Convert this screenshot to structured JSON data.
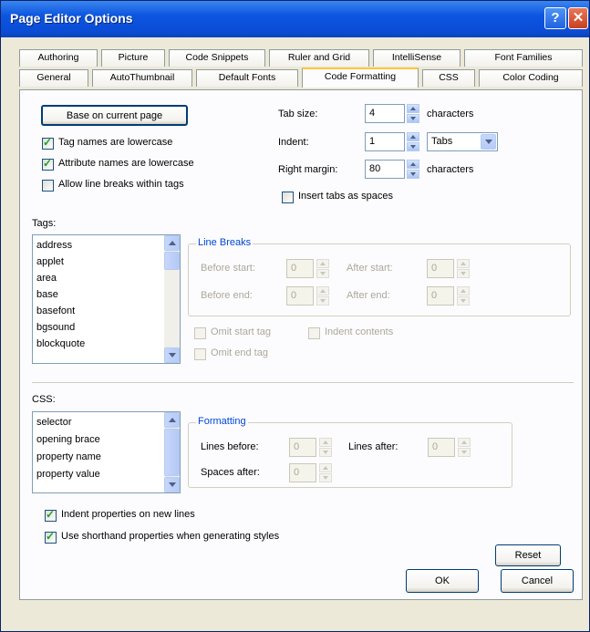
{
  "window": {
    "title": "Page Editor Options",
    "help_glyph": "?",
    "close_glyph": "✕"
  },
  "tabs_row1": [
    "Authoring",
    "Picture",
    "Code Snippets",
    "Ruler and Grid",
    "IntelliSense",
    "Font Families"
  ],
  "tabs_row2": [
    "General",
    "AutoThumbnail",
    "Default Fonts",
    "Code Formatting",
    "CSS",
    "Color Coding"
  ],
  "active_tab": "Code Formatting",
  "code_formatting": {
    "base_button": "Base on current page",
    "checkboxes": [
      {
        "label": "Tag names are lowercase",
        "checked": true
      },
      {
        "label": "Attribute names are lowercase",
        "checked": true
      },
      {
        "label": "Allow line breaks within tags",
        "checked": false
      }
    ],
    "tab_size": {
      "label": "Tab size:",
      "value": "4",
      "suffix": "characters"
    },
    "indent": {
      "label": "Indent:",
      "value": "1",
      "unit": "Tabs"
    },
    "right_margin": {
      "label": "Right margin:",
      "value": "80",
      "suffix": "characters"
    },
    "insert_tabs": {
      "label": "Insert tabs as spaces",
      "checked": false
    }
  },
  "tags": {
    "label": "Tags:",
    "items": [
      "address",
      "applet",
      "area",
      "base",
      "basefont",
      "bgsound",
      "blockquote"
    ],
    "line_breaks": {
      "title": "Line Breaks",
      "before_start": "Before start:",
      "after_start": "After start:",
      "before_end": "Before end:",
      "after_end": "After end:",
      "before_start_value": "0",
      "after_start_value": "0",
      "before_end_value": "0",
      "after_end_value": "0"
    },
    "omit_start": "Omit start tag",
    "indent_contents": "Indent contents",
    "omit_end": "Omit end tag"
  },
  "css": {
    "label": "CSS:",
    "items": [
      "selector",
      "opening brace",
      "property name",
      "property value"
    ],
    "formatting": {
      "title": "Formatting",
      "lines_before": "Lines before:",
      "lines_after": "Lines after:",
      "spaces_after": "Spaces after:",
      "lines_before_value": "0",
      "lines_after_value": "0",
      "spaces_after_value": "0"
    },
    "indent_props": {
      "label": "Indent properties on new lines",
      "checked": true
    },
    "shorthand": {
      "label": "Use shorthand properties when generating styles",
      "checked": true
    }
  },
  "reset_button": "Reset",
  "ok_button": "OK",
  "cancel_button": "Cancel",
  "colors": {
    "titlebar": "#0A4CD6",
    "dialog_bg": "#ECE9D8",
    "group_title": "#0046D5",
    "active_tab_accent": "#FFC73C"
  }
}
